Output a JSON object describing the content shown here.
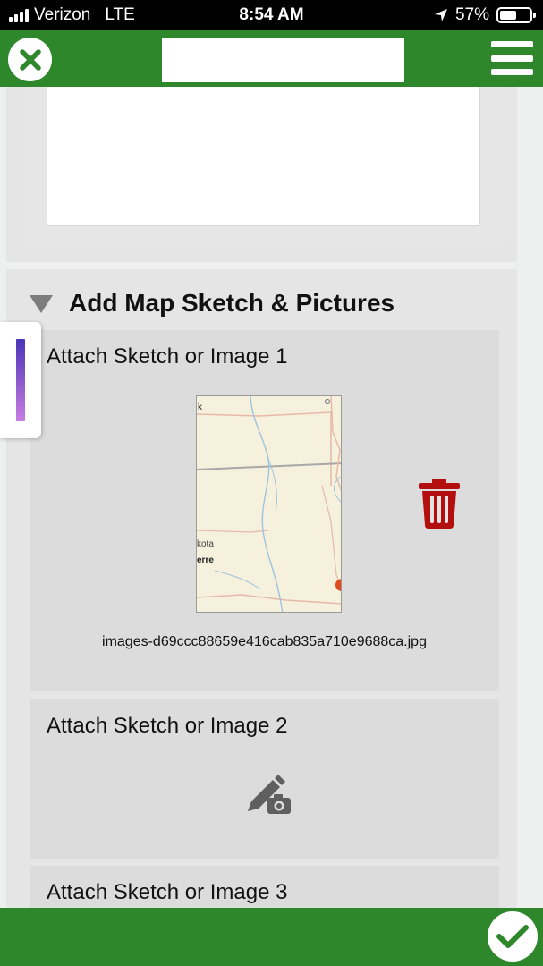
{
  "status_bar": {
    "carrier": "Verizon",
    "network": "LTE",
    "time": "8:54 AM",
    "battery_percent": "57%",
    "battery_level": 0.57
  },
  "app_bar": {
    "close_icon": "close-circle-icon",
    "menu_icon": "hamburger-menu-icon",
    "title": ""
  },
  "section": {
    "title": "Add Map Sketch & Pictures",
    "expanded": true,
    "attachments": [
      {
        "label": "Attach Sketch or Image 1",
        "filename": "images-d69ccc88659e416cab835a710e9688ca.jpg",
        "has_image": true
      },
      {
        "label": "Attach Sketch or Image 2",
        "has_image": false
      },
      {
        "label": "Attach Sketch or Image 3",
        "has_image": false
      }
    ]
  },
  "map_thumbnail": {
    "labels": [
      "k",
      "kota",
      "erre"
    ]
  },
  "colors": {
    "brand_green": "#2e872a",
    "delete_red": "#b30f0f",
    "handle_gradient_top": "#4b35b8",
    "handle_gradient_bottom": "#c77de0"
  },
  "icons": {
    "delete": "trash-icon",
    "add_attachment": "pencil-camera-icon",
    "submit": "checkmark-icon"
  }
}
